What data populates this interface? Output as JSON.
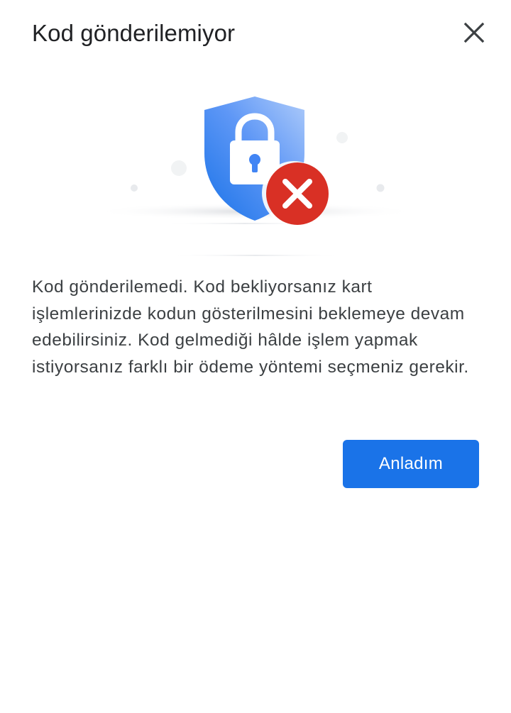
{
  "dialog": {
    "title": "Kod gönderilemiyor",
    "close_icon": "close-icon",
    "illustration_icon": "security-shield-lock-error-icon",
    "message": "Kod gönderilemedi. Kod bekliyorsanız kart işlemlerinizde kodun gösterilmesini beklemeye devam edebilirsiniz. Kod gelmediği hâlde işlem yapmak istiyorsanız farklı bir ödeme yöntemi seçmeniz gerekir.",
    "confirm_label": "Anladım"
  },
  "colors": {
    "accent": "#1a73e8",
    "shield": "#4285f4",
    "error": "#d93025",
    "title_text": "#202124",
    "body_text": "#3c4043"
  }
}
